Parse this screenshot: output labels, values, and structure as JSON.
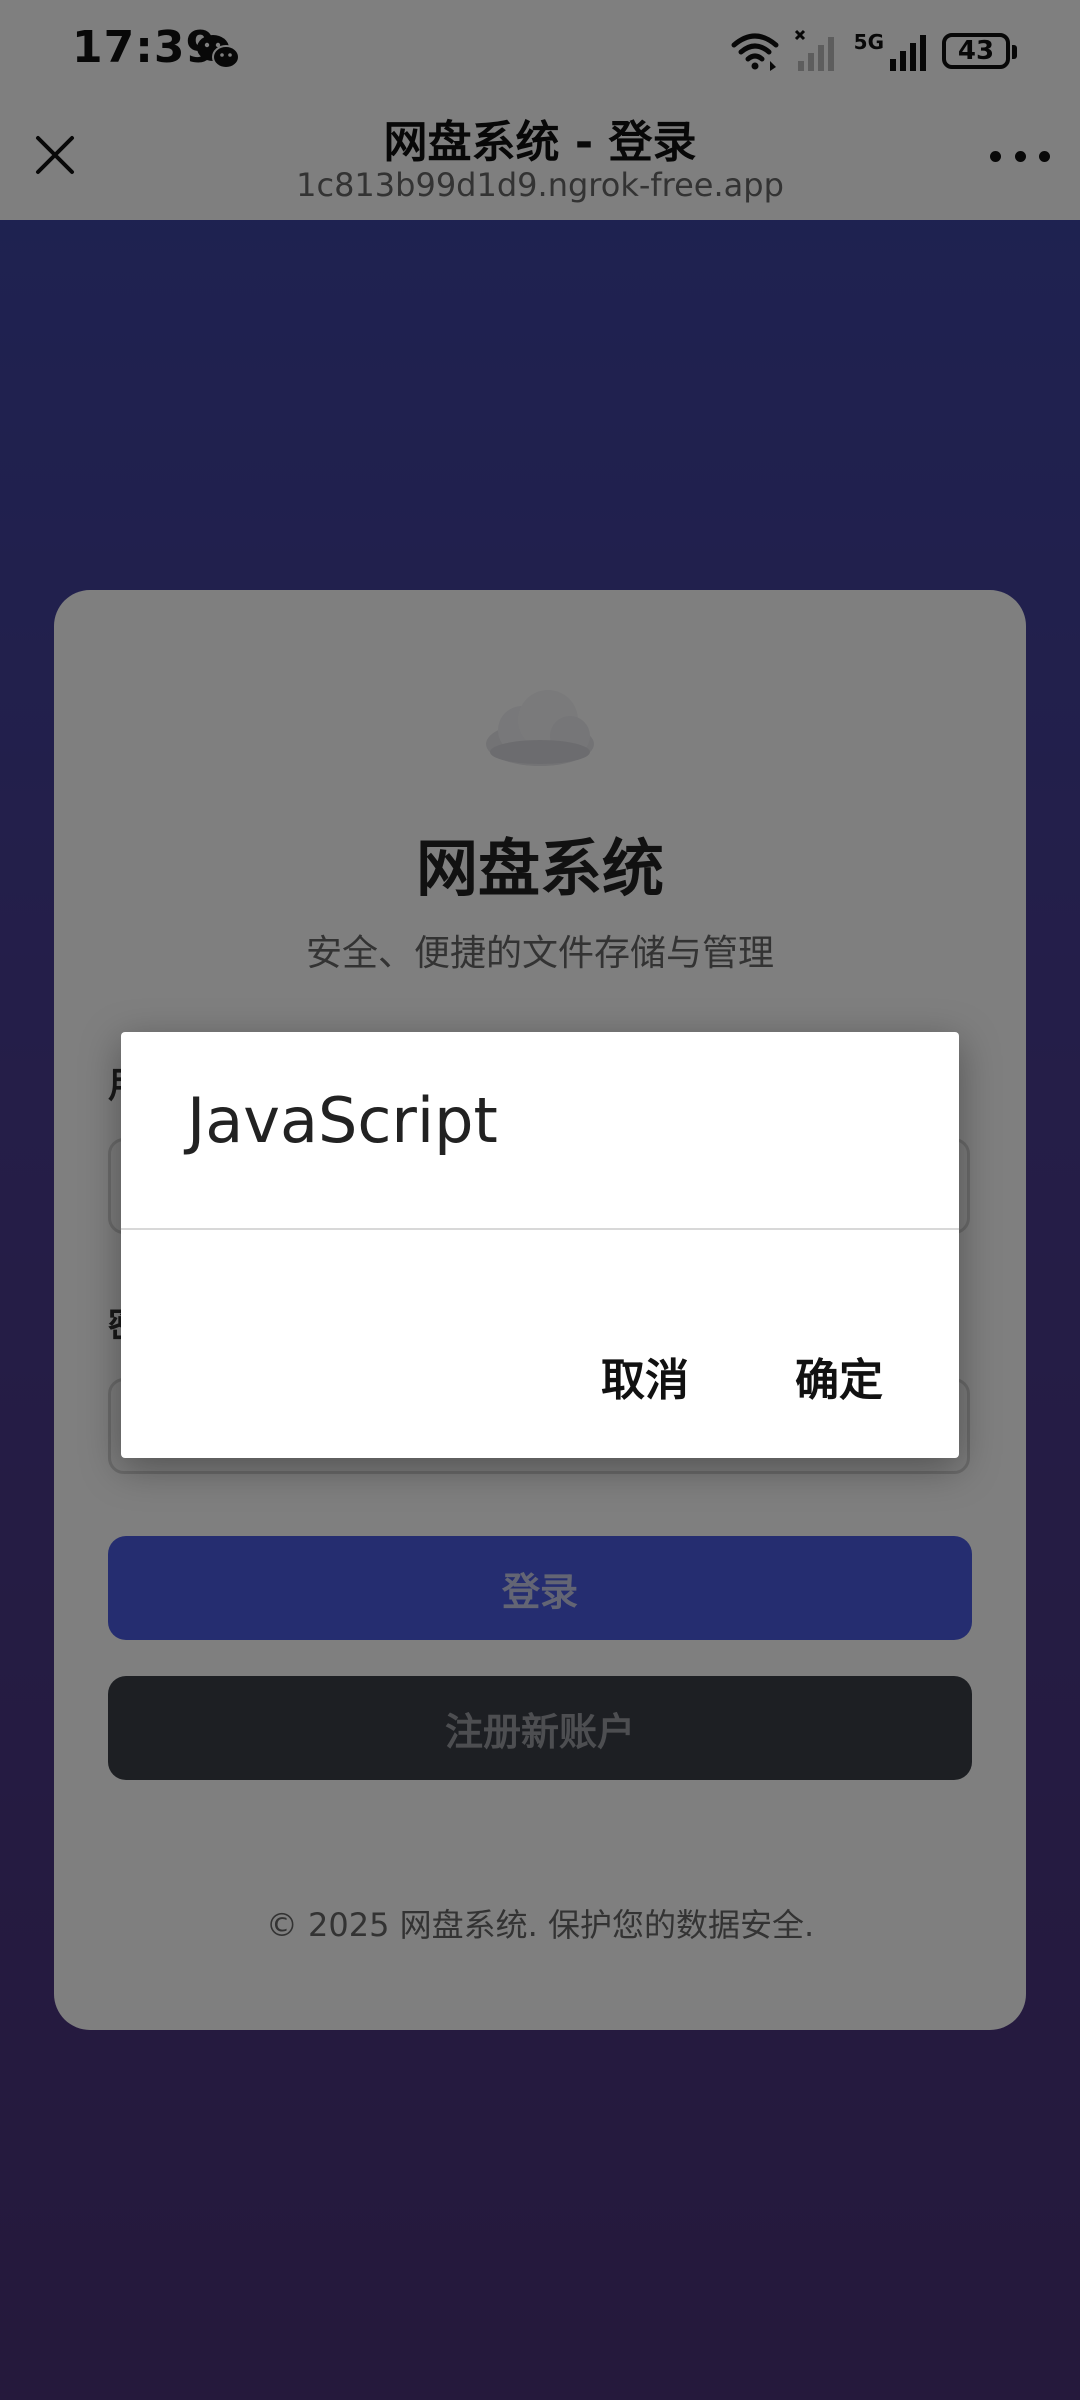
{
  "status_bar": {
    "time": "17:39",
    "network_label": "5G",
    "battery_level": "43",
    "icons": [
      "wechat-icon",
      "wifi-icon",
      "signal-off-icon",
      "signal-5g-icon",
      "battery-icon"
    ]
  },
  "header": {
    "title": "网盘系统 - 登录",
    "url": "1c813b99d1d9.ngrok-free.app",
    "close_icon": "close-icon",
    "more_icon": "more-icon"
  },
  "login_card": {
    "title": "网盘系统",
    "subtitle": "安全、便捷的文件存储与管理",
    "username_label": "用",
    "password_label": "密",
    "login_button_label": "登录",
    "register_button_label": "注册新账户",
    "footer": "© 2025 网盘系统. 保护您的数据安全."
  },
  "dialog": {
    "title": "JavaScript",
    "cancel_label": "取消",
    "ok_label": "确定"
  },
  "colors": {
    "background_top": "#3a46a6",
    "background_bottom": "#4a3278",
    "login_button": "#4a5be0",
    "register_button": "#3a3f47"
  }
}
